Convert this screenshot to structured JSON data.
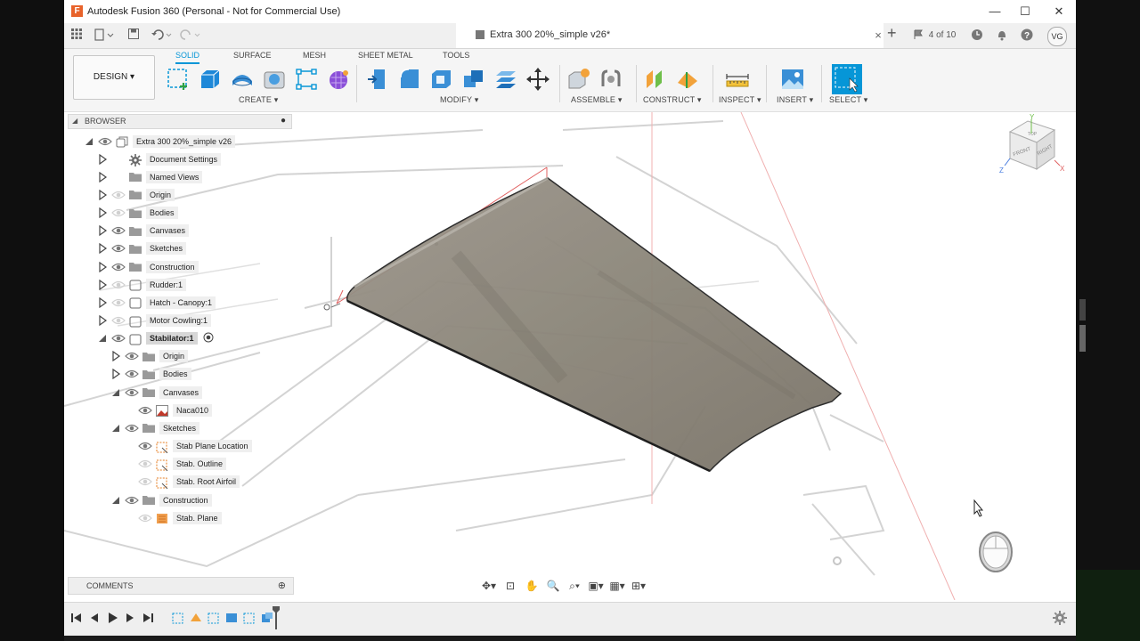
{
  "window": {
    "title": "Autodesk Fusion 360 (Personal - Not for Commercial Use)",
    "logo_letter": "F",
    "minimize": "—",
    "maximize": "☐",
    "close": "✕"
  },
  "tabbar": {
    "doc_name": "Extra 300 20%_simple v26*",
    "close_tab": "×",
    "new_tab": "+",
    "job_status": "4 of 10",
    "user_initials": "VG"
  },
  "toolbar": {
    "workspace": "DESIGN ▾",
    "tabs": [
      "SOLID",
      "SURFACE",
      "MESH",
      "SHEET METAL",
      "TOOLS"
    ],
    "active_tab": "SOLID",
    "groups": [
      "CREATE ▾",
      "MODIFY ▾",
      "ASSEMBLE ▾",
      "CONSTRUCT ▾",
      "INSPECT ▾",
      "INSERT ▾",
      "SELECT ▾"
    ]
  },
  "browser": {
    "title": "BROWSER",
    "items": [
      {
        "label": "Extra 300 20%_simple v26",
        "level": 0,
        "expanded": true,
        "eye": "on",
        "icon": "document-icon"
      },
      {
        "label": "Document Settings",
        "level": 1,
        "expanded": false,
        "eye": "none",
        "icon": "gear-icon"
      },
      {
        "label": "Named Views",
        "level": 1,
        "expanded": false,
        "eye": "none",
        "icon": "folder-icon"
      },
      {
        "label": "Origin",
        "level": 1,
        "expanded": false,
        "eye": "off",
        "icon": "folder-icon"
      },
      {
        "label": "Bodies",
        "level": 1,
        "expanded": false,
        "eye": "off",
        "icon": "folder-icon"
      },
      {
        "label": "Canvases",
        "level": 1,
        "expanded": false,
        "eye": "on",
        "icon": "folder-icon"
      },
      {
        "label": "Sketches",
        "level": 1,
        "expanded": false,
        "eye": "on",
        "icon": "folder-icon"
      },
      {
        "label": "Construction",
        "level": 1,
        "expanded": false,
        "eye": "on",
        "icon": "folder-icon"
      },
      {
        "label": "Rudder:1",
        "level": 1,
        "expanded": false,
        "eye": "off",
        "icon": "component-icon"
      },
      {
        "label": "Hatch - Canopy:1",
        "level": 1,
        "expanded": false,
        "eye": "off",
        "icon": "component-icon"
      },
      {
        "label": "Motor Cowling:1",
        "level": 1,
        "expanded": false,
        "eye": "off",
        "icon": "component-icon"
      },
      {
        "label": "Stabilator:1",
        "level": 1,
        "expanded": true,
        "eye": "on",
        "icon": "component-icon",
        "selected": true
      },
      {
        "label": "Origin",
        "level": 2,
        "expanded": false,
        "eye": "on",
        "icon": "folder-icon"
      },
      {
        "label": "Bodies",
        "level": 2,
        "expanded": false,
        "eye": "on",
        "icon": "folder-icon"
      },
      {
        "label": "Canvases",
        "level": 2,
        "expanded": true,
        "eye": "on",
        "icon": "folder-icon"
      },
      {
        "label": "Naca010",
        "level": 3,
        "expanded": null,
        "eye": "on",
        "icon": "canvas-icon"
      },
      {
        "label": "Sketches",
        "level": 2,
        "expanded": true,
        "eye": "on",
        "icon": "folder-icon"
      },
      {
        "label": "Stab Plane Location",
        "level": 3,
        "expanded": null,
        "eye": "on",
        "icon": "sketch-icon"
      },
      {
        "label": "Stab. Outline",
        "level": 3,
        "expanded": null,
        "eye": "off",
        "icon": "sketch-icon"
      },
      {
        "label": "Stab. Root Airfoil",
        "level": 3,
        "expanded": null,
        "eye": "off",
        "icon": "sketch-icon"
      },
      {
        "label": "Construction",
        "level": 2,
        "expanded": true,
        "eye": "on",
        "icon": "folder-icon"
      },
      {
        "label": "Stab. Plane",
        "level": 3,
        "expanded": null,
        "eye": "off",
        "icon": "plane-icon"
      }
    ]
  },
  "comments": {
    "title": "COMMENTS"
  },
  "viewcube": {
    "top": "TOP",
    "front": "FRONT",
    "right": "RIGHT",
    "x": "X",
    "y": "Y",
    "z": "Z"
  },
  "colors": {
    "accent": "#0696d7",
    "brand": "#e8632b",
    "body": "#8a8478"
  }
}
